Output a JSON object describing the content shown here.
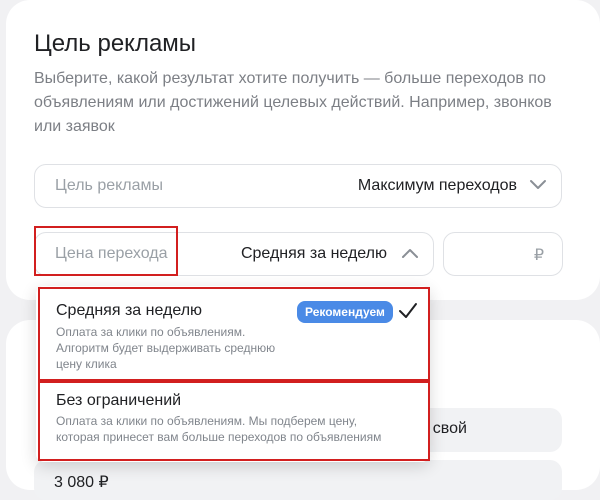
{
  "section": {
    "title": "Цель рекламы",
    "description": "Выберите, какой результат хотите получить — больше переходов по объявлениям или достижений целевых действий. Например, звонков или заявок"
  },
  "goal_field": {
    "label": "Цель рекламы",
    "value": "Максимум переходов",
    "icon": "chevron-down-icon"
  },
  "price_field": {
    "label": "Цена перехода",
    "value": "Средняя за неделю",
    "icon": "chevron-up-icon"
  },
  "amount_field": {
    "currency": "₽"
  },
  "dropdown": {
    "options": [
      {
        "label": "Средняя за неделю",
        "badge": "Рекомендуем",
        "description": "Оплата за клики по объявлениям. Алгоритм будет выдерживать среднюю цену клика",
        "selected": true
      },
      {
        "label": "Без ограничений",
        "description": "Оплата за клики по объявлениям. Мы подберем цену, которая принесет вам больше переходов по объявлениям",
        "selected": false
      }
    ]
  },
  "background": {
    "button_text": "ь свой",
    "field_value": "3 080 ₽"
  },
  "colors": {
    "accent": "#4a8ae6",
    "highlight": "#d21f1f",
    "muted_text": "#7c7f85"
  }
}
